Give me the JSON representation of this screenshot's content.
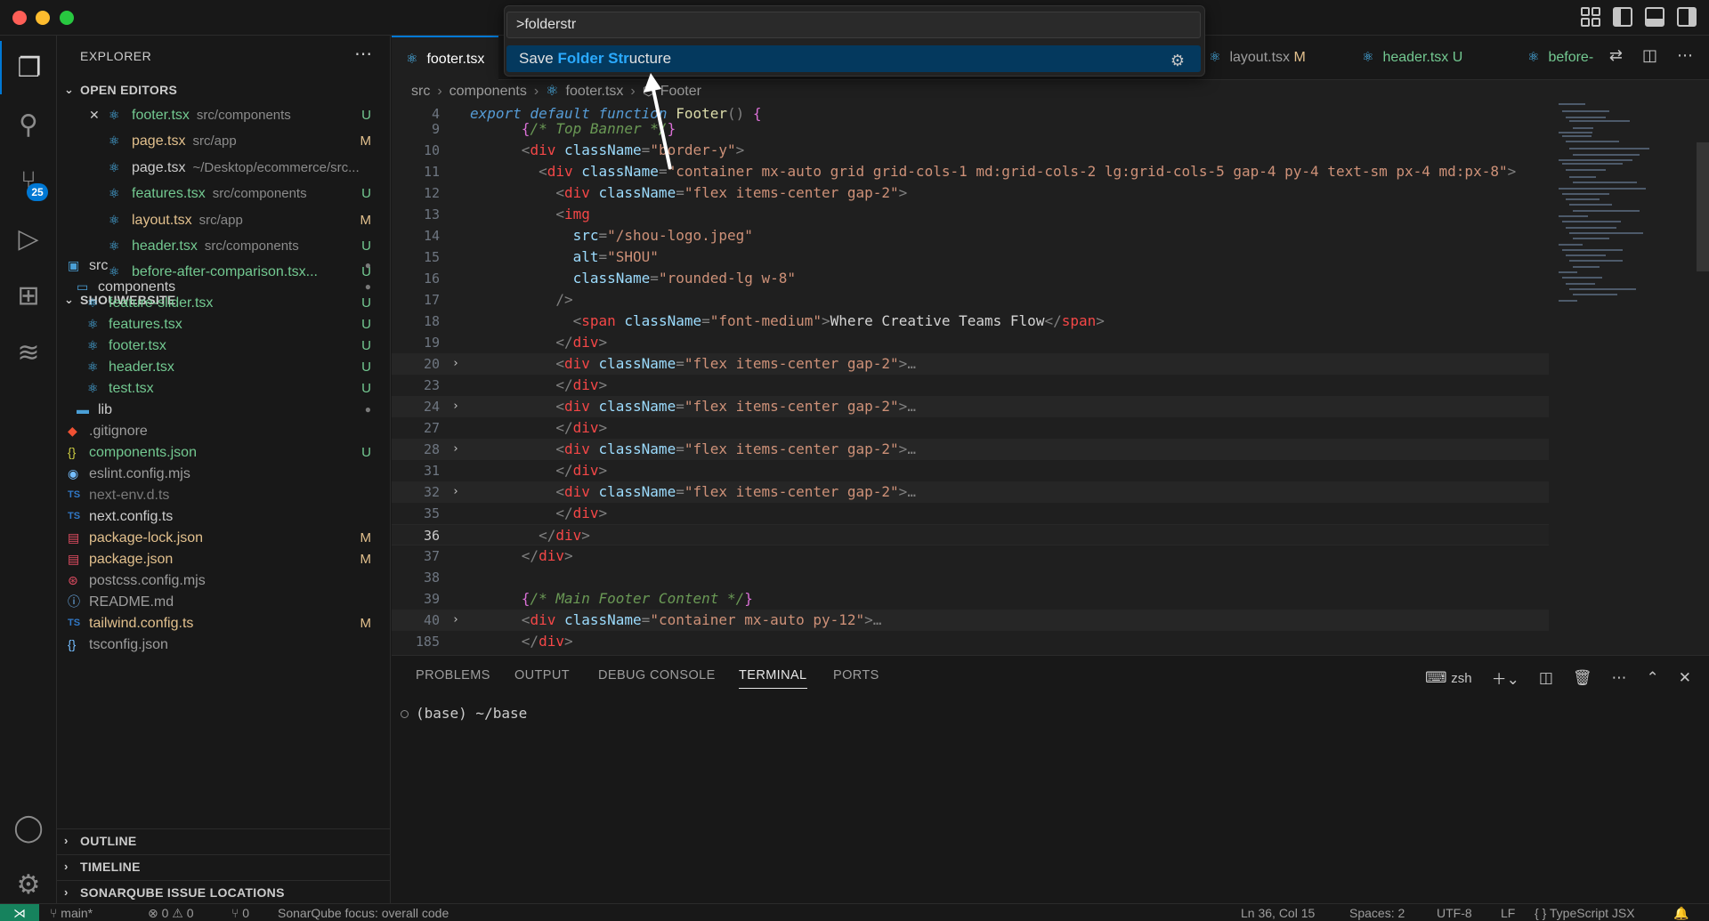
{
  "palette": {
    "query": ">folderstr",
    "result": {
      "pre": "Save ",
      "match": "Folder Str",
      "post": "ucture"
    }
  },
  "activity": {
    "source_control_badge": "25"
  },
  "sidebar": {
    "title": "EXPLORER",
    "open_editors_title": "OPEN EDITORS",
    "open_editors": [
      {
        "name": "footer.tsx",
        "path": "src/components",
        "status": "U"
      },
      {
        "name": "page.tsx",
        "path": "src/app",
        "status": "M"
      },
      {
        "name": "page.tsx",
        "path": "~/Desktop/ecommerce/src...",
        "status": ""
      },
      {
        "name": "features.tsx",
        "path": "src/components",
        "status": "U"
      },
      {
        "name": "layout.tsx",
        "path": "src/app",
        "status": "M"
      },
      {
        "name": "header.tsx",
        "path": "src/components",
        "status": "U"
      },
      {
        "name": "before-after-comparison.tsx...",
        "path": "",
        "status": "U"
      }
    ],
    "project_title": "SHOUWEBSITE",
    "tree": [
      {
        "name": "src",
        "status": "●"
      },
      {
        "name": "components",
        "status": "●"
      },
      {
        "name": "feature-slider.tsx",
        "status": "U"
      },
      {
        "name": "features.tsx",
        "status": "U"
      },
      {
        "name": "footer.tsx",
        "status": "U"
      },
      {
        "name": "header.tsx",
        "status": "U"
      },
      {
        "name": "test.tsx",
        "status": "U"
      },
      {
        "name": "lib",
        "status": "●"
      },
      {
        "name": ".gitignore",
        "status": ""
      },
      {
        "name": "components.json",
        "status": "U"
      },
      {
        "name": "eslint.config.mjs",
        "status": ""
      },
      {
        "name": "next-env.d.ts",
        "status": ""
      },
      {
        "name": "next.config.ts",
        "status": ""
      },
      {
        "name": "package-lock.json",
        "status": "M"
      },
      {
        "name": "package.json",
        "status": "M"
      },
      {
        "name": "postcss.config.mjs",
        "status": ""
      },
      {
        "name": "README.md",
        "status": ""
      },
      {
        "name": "tailwind.config.ts",
        "status": "M"
      },
      {
        "name": "tsconfig.json",
        "status": ""
      }
    ],
    "sections": [
      "OUTLINE",
      "TIMELINE",
      "SONARQUBE ISSUE LOCATIONS"
    ]
  },
  "tabs": [
    {
      "name": "footer.tsx",
      "status": ""
    },
    {
      "name": "layout.tsx",
      "status": "M"
    },
    {
      "name": "header.tsx",
      "status": "U"
    },
    {
      "name": "before-",
      "status": ""
    }
  ],
  "breadcrumb": [
    "src",
    "components",
    "footer.tsx",
    "Footer"
  ],
  "editor": {
    "lines": [
      {
        "n": "4",
        "segs": [
          [
            "kw",
            "export default "
          ],
          [
            "kw",
            "function "
          ],
          [
            "fn",
            "Footer"
          ],
          [
            "pn",
            "() "
          ],
          [
            "br",
            "{"
          ]
        ]
      },
      {
        "n": "9",
        "segs": [
          [
            "pn",
            "      "
          ],
          [
            "br",
            "{"
          ],
          [
            "cm",
            "/* Top Banner */"
          ],
          [
            "br",
            "}"
          ]
        ]
      },
      {
        "n": "10",
        "segs": [
          [
            "pn",
            "      <"
          ],
          [
            "tag",
            "div "
          ],
          [
            "attr",
            "className"
          ],
          [
            "pn",
            "="
          ],
          [
            "str",
            "\"border-y\""
          ],
          [
            "pn",
            ">"
          ]
        ]
      },
      {
        "n": "11",
        "segs": [
          [
            "pn",
            "        <"
          ],
          [
            "tag",
            "div "
          ],
          [
            "attr",
            "className"
          ],
          [
            "pn",
            "="
          ],
          [
            "str",
            "\"container mx-auto grid grid-cols-1 md:grid-cols-2 lg:grid-cols-5 gap-4 py-4 text-sm px-4 md:px-8\""
          ],
          [
            "pn",
            ">"
          ]
        ]
      },
      {
        "n": "12",
        "segs": [
          [
            "pn",
            "          <"
          ],
          [
            "tag",
            "div "
          ],
          [
            "attr",
            "className"
          ],
          [
            "pn",
            "="
          ],
          [
            "str",
            "\"flex items-center gap-2\""
          ],
          [
            "pn",
            ">"
          ]
        ]
      },
      {
        "n": "13",
        "segs": [
          [
            "pn",
            "          <"
          ],
          [
            "tag",
            "img"
          ]
        ]
      },
      {
        "n": "14",
        "segs": [
          [
            "pn",
            "            "
          ],
          [
            "attr",
            "src"
          ],
          [
            "pn",
            "="
          ],
          [
            "str",
            "\"/shou-logo.jpeg\""
          ]
        ]
      },
      {
        "n": "15",
        "segs": [
          [
            "pn",
            "            "
          ],
          [
            "attr",
            "alt"
          ],
          [
            "pn",
            "="
          ],
          [
            "str",
            "\"SHOU\""
          ]
        ]
      },
      {
        "n": "16",
        "segs": [
          [
            "pn",
            "            "
          ],
          [
            "attr",
            "className"
          ],
          [
            "pn",
            "="
          ],
          [
            "str",
            "\"rounded-lg w-8\""
          ]
        ]
      },
      {
        "n": "17",
        "segs": [
          [
            "pn",
            "          />"
          ]
        ]
      },
      {
        "n": "18",
        "segs": [
          [
            "pn",
            "            <"
          ],
          [
            "tag",
            "span "
          ],
          [
            "attr",
            "className"
          ],
          [
            "pn",
            "="
          ],
          [
            "str",
            "\"font-medium\""
          ],
          [
            "pn",
            ">"
          ],
          [
            "txt",
            "Where Creative Teams Flow"
          ],
          [
            "pn",
            "</"
          ],
          [
            "tag",
            "span"
          ],
          [
            "pn",
            ">"
          ]
        ]
      },
      {
        "n": "19",
        "segs": [
          [
            "pn",
            "          </"
          ],
          [
            "tag",
            "div"
          ],
          [
            "pn",
            ">"
          ]
        ]
      },
      {
        "n": "20",
        "fold": true,
        "hl": true,
        "segs": [
          [
            "pn",
            "          <"
          ],
          [
            "tag",
            "div "
          ],
          [
            "attr",
            "className"
          ],
          [
            "pn",
            "="
          ],
          [
            "str",
            "\"flex items-center gap-2\""
          ],
          [
            "pn",
            ">"
          ],
          [
            "dots",
            "…"
          ]
        ]
      },
      {
        "n": "23",
        "segs": [
          [
            "pn",
            "          </"
          ],
          [
            "tag",
            "div"
          ],
          [
            "pn",
            ">"
          ]
        ]
      },
      {
        "n": "24",
        "fold": true,
        "hl": true,
        "segs": [
          [
            "pn",
            "          <"
          ],
          [
            "tag",
            "div "
          ],
          [
            "attr",
            "className"
          ],
          [
            "pn",
            "="
          ],
          [
            "str",
            "\"flex items-center gap-2\""
          ],
          [
            "pn",
            ">"
          ],
          [
            "dots",
            "…"
          ]
        ]
      },
      {
        "n": "27",
        "segs": [
          [
            "pn",
            "          </"
          ],
          [
            "tag",
            "div"
          ],
          [
            "pn",
            ">"
          ]
        ]
      },
      {
        "n": "28",
        "fold": true,
        "hl": true,
        "segs": [
          [
            "pn",
            "          <"
          ],
          [
            "tag",
            "div "
          ],
          [
            "attr",
            "className"
          ],
          [
            "pn",
            "="
          ],
          [
            "str",
            "\"flex items-center gap-2\""
          ],
          [
            "pn",
            ">"
          ],
          [
            "dots",
            "…"
          ]
        ]
      },
      {
        "n": "31",
        "segs": [
          [
            "pn",
            "          </"
          ],
          [
            "tag",
            "div"
          ],
          [
            "pn",
            ">"
          ]
        ]
      },
      {
        "n": "32",
        "fold": true,
        "hl": true,
        "segs": [
          [
            "pn",
            "          <"
          ],
          [
            "tag",
            "div "
          ],
          [
            "attr",
            "className"
          ],
          [
            "pn",
            "="
          ],
          [
            "str",
            "\"flex items-center gap-2\""
          ],
          [
            "pn",
            ">"
          ],
          [
            "dots",
            "…"
          ]
        ]
      },
      {
        "n": "35",
        "segs": [
          [
            "pn",
            "          </"
          ],
          [
            "tag",
            "div"
          ],
          [
            "pn",
            ">"
          ]
        ]
      },
      {
        "n": "36",
        "cur": true,
        "segs": [
          [
            "pn",
            "        </"
          ],
          [
            "tag",
            "div"
          ],
          [
            "pn",
            ">"
          ]
        ]
      },
      {
        "n": "37",
        "segs": [
          [
            "pn",
            "      </"
          ],
          [
            "tag",
            "div"
          ],
          [
            "pn",
            ">"
          ]
        ]
      },
      {
        "n": "38",
        "segs": []
      },
      {
        "n": "39",
        "segs": [
          [
            "pn",
            "      "
          ],
          [
            "br",
            "{"
          ],
          [
            "cm",
            "/* Main Footer Content */"
          ],
          [
            "br",
            "}"
          ]
        ]
      },
      {
        "n": "40",
        "fold": true,
        "hl": true,
        "segs": [
          [
            "pn",
            "      <"
          ],
          [
            "tag",
            "div "
          ],
          [
            "attr",
            "className"
          ],
          [
            "pn",
            "="
          ],
          [
            "str",
            "\"container mx-auto py-12\""
          ],
          [
            "pn",
            ">"
          ],
          [
            "dots",
            "…"
          ]
        ]
      },
      {
        "n": "185",
        "segs": [
          [
            "pn",
            "      </"
          ],
          [
            "tag",
            "div"
          ],
          [
            "pn",
            ">"
          ]
        ]
      }
    ]
  },
  "panel": {
    "tabs": [
      "PROBLEMS",
      "OUTPUT",
      "DEBUG CONSOLE",
      "TERMINAL",
      "PORTS"
    ],
    "active_tab": "TERMINAL",
    "shell": "zsh",
    "terminal_line": "(base) ~/base"
  },
  "status": {
    "branch": "main*",
    "problems": "⊗ 0 ⚠ 0",
    "ports": "⑂ 0",
    "sonar": "SonarQube focus: overall code",
    "position": "Ln 36, Col 15",
    "spaces": "Spaces: 2",
    "encoding": "UTF-8",
    "eol": "LF",
    "language": "{ } TypeScript JSX"
  }
}
